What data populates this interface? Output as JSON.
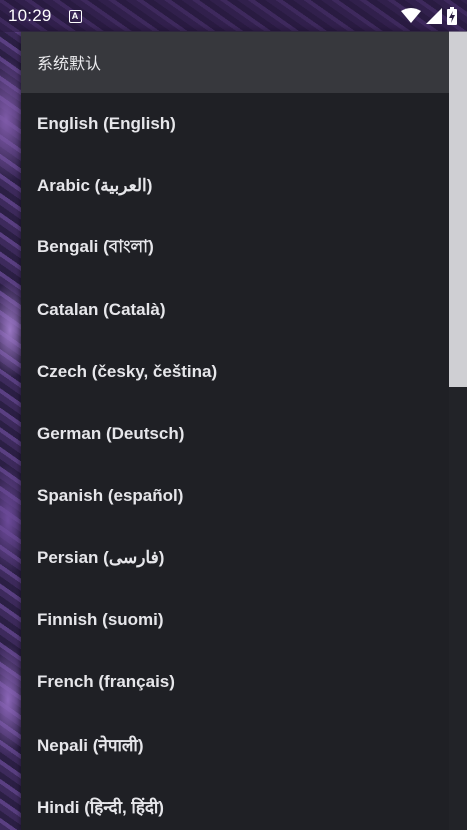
{
  "statusbar": {
    "time": "10:29",
    "notification_glyph": "A",
    "icons": [
      "wifi-icon",
      "cell-signal-icon",
      "battery-charging-icon"
    ]
  },
  "language_menu": {
    "items": [
      {
        "label": "系统默认",
        "selected": true
      },
      {
        "label": "English (English)"
      },
      {
        "label": "Arabic (العربية)"
      },
      {
        "label": "Bengali (বাংলা)"
      },
      {
        "label": "Catalan (Català)"
      },
      {
        "label": "Czech (česky, čeština)"
      },
      {
        "label": "German (Deutsch)"
      },
      {
        "label": "Spanish (español)"
      },
      {
        "label": "Persian (فارسی)"
      },
      {
        "label": "Finnish (suomi)"
      },
      {
        "label": "French (français)"
      },
      {
        "label": "Nepali (नेपाली)"
      },
      {
        "label": "Hindi (हिन्दी, हिंदी)"
      }
    ]
  },
  "colors": {
    "menu_background": "#1f2025",
    "selected_background": "#37383d",
    "text": "#e6e6ea",
    "scroll_thumb": "#cfcfd3"
  }
}
